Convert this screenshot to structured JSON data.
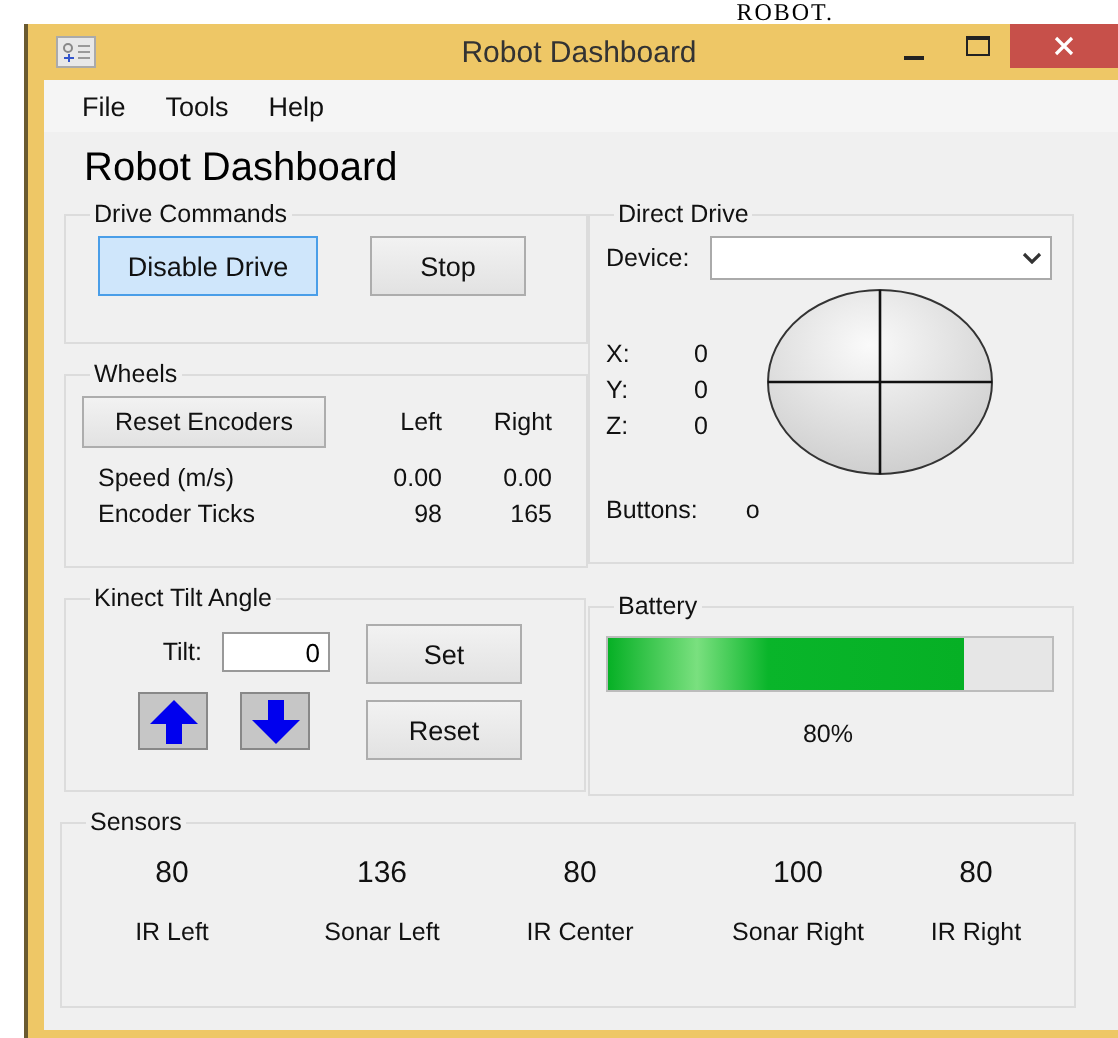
{
  "caption": "ROBOT.",
  "window": {
    "title": "Robot Dashboard"
  },
  "menu": [
    "File",
    "Tools",
    "Help"
  ],
  "heading": "Robot Dashboard",
  "drive_commands": {
    "title": "Drive Commands",
    "buttons": [
      {
        "label": "Disable Drive",
        "focused": true
      },
      {
        "label": "Stop",
        "focused": false
      }
    ]
  },
  "wheels": {
    "title": "Wheels",
    "button": "Reset Encoders",
    "columns": [
      "Left",
      "Right"
    ],
    "rows": [
      {
        "label": "Speed (m/s)",
        "values": [
          "0.00",
          "0.00"
        ]
      },
      {
        "label": "Encoder Ticks",
        "values": [
          "98",
          "165"
        ]
      }
    ]
  },
  "kinect": {
    "title": "Kinect Tilt Angle",
    "tilt_label": "Tilt:",
    "tilt_value": "0",
    "buttons": [
      "Set",
      "Reset"
    ]
  },
  "direct_drive": {
    "title": "Direct Drive",
    "device_label": "Device:",
    "axes": [
      {
        "label": "X:",
        "value": "0"
      },
      {
        "label": "Y:",
        "value": "0"
      },
      {
        "label": "Z:",
        "value": "0"
      }
    ],
    "buttons_label": "Buttons:",
    "buttons_value": "o"
  },
  "battery": {
    "title": "Battery",
    "level": 0.8,
    "reading": "80%"
  },
  "sensors": {
    "title": "Sensors",
    "items": [
      {
        "value": "80",
        "label": "IR Left"
      },
      {
        "value": "136",
        "label": "Sonar Left"
      },
      {
        "value": "80",
        "label": "IR Center"
      },
      {
        "value": "100",
        "label": "Sonar Right"
      },
      {
        "value": "80",
        "label": "IR Right"
      }
    ]
  }
}
